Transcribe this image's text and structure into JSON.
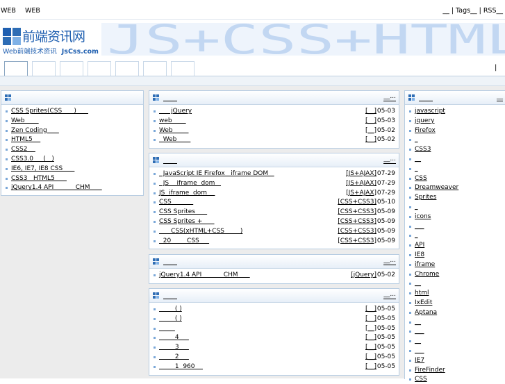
{
  "topbar": {
    "left_links": [
      "WEB",
      "WEB"
    ],
    "right_text": "__ | Tags__ | RSS__"
  },
  "logo": {
    "title": "前端资讯网",
    "subtitle": "Web前端技术资讯",
    "domain": "JsCss.com"
  },
  "banner": {
    "text": "JS+CSS+HTML"
  },
  "tabs_pipe": "|",
  "colors": {
    "accent": "#2e6db5",
    "banner_text": "#c2d7f2",
    "banner_bg": "#eef4fc",
    "box_border": "#b8cde2",
    "page_bg": "#ececec"
  },
  "left_box": {
    "items": [
      "CSS Sprites(CSS      )      ",
      "Web       ",
      "Zen Coding      ",
      "HTML5    ",
      "CSS2    ",
      "CSS3.0     (   )",
      "IE6, IE7, IE8 CSS      ",
      "CSS3   HTML5      ",
      "jQuery1.4 API           CHM      "
    ]
  },
  "mid_boxes": [
    {
      "more": "__...",
      "rows": [
        {
          "title": "      jQuery",
          "cat": "[__]",
          "date": "05-03"
        },
        {
          "title": "web       ",
          "cat": "[__]",
          "date": "05-03"
        },
        {
          "title": "Web        ",
          "cat": "[__]",
          "date": "05-02"
        },
        {
          "title": "  Web       ",
          "cat": "[__]",
          "date": "05-02"
        }
      ]
    },
    {
      "more": "__...",
      "rows": [
        {
          "title": "  JavaScript IE Firefox   iframe DOM   ",
          "cat": "[JS+AJAX]",
          "date": "07-29"
        },
        {
          "title": "  JS    iframe  dom   ",
          "cat": "[JS+AJAX]",
          "date": "07-29"
        },
        {
          "title": "JS  iframe  dom    ",
          "cat": "[JS+AJAX]",
          "date": "07-29"
        },
        {
          "title": "CSS           ",
          "cat": "[CSS+CSS3]",
          "date": "05-10"
        },
        {
          "title": "CSS Sprites      ",
          "cat": "[CSS+CSS3]",
          "date": "05-09"
        },
        {
          "title": "CSS Sprites +      ",
          "cat": "[CSS+CSS3]",
          "date": "05-09"
        },
        {
          "title": "      CSS(xHTML+CSS        )",
          "cat": "[CSS+CSS3]",
          "date": "05-09"
        },
        {
          "title": "  20        CSS     ",
          "cat": "[CSS+CSS3]",
          "date": "05-09"
        }
      ]
    },
    {
      "more": "__...",
      "rows": [
        {
          "title": "jQuery1.4 API           CHM      ",
          "cat": "[jQuery]",
          "date": "05-02"
        }
      ]
    },
    {
      "more": "__...",
      "rows": [
        {
          "title": "        ( )",
          "cat": "[__]",
          "date": "05-05"
        },
        {
          "title": "        ( )",
          "cat": "[__]",
          "date": "05-05"
        },
        {
          "title": "        ",
          "cat": "[__]",
          "date": "05-05"
        },
        {
          "title": "        4     ",
          "cat": "[__]",
          "date": "05-05"
        },
        {
          "title": "        3     ",
          "cat": "[__]",
          "date": "05-05"
        },
        {
          "title": "        2     ",
          "cat": "[__]",
          "date": "05-05"
        },
        {
          "title": "        1  960    ",
          "cat": "[__]",
          "date": "05-05"
        }
      ]
    }
  ],
  "right_box": {
    "more": "__",
    "items": [
      "javascript",
      "jquery",
      "Firefox",
      "_",
      "CSS3",
      "__",
      "_",
      "CSS",
      "Dreamweaver",
      "Sprites",
      "_",
      "icons",
      "___",
      "_",
      "API",
      "IE8",
      "iframe",
      "Chrome",
      "__",
      "html",
      "IxEdit",
      "Aptana",
      "__",
      "___",
      "__",
      "___",
      "IE7",
      "FireFinder",
      "CSS"
    ]
  }
}
